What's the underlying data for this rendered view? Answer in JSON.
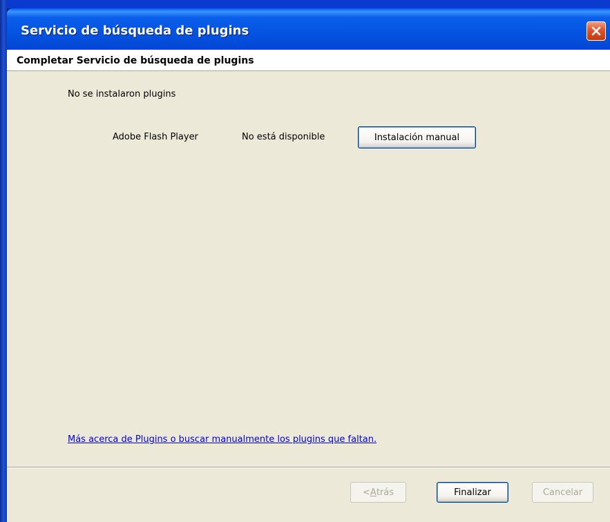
{
  "window": {
    "title": "Servicio de búsqueda de plugins"
  },
  "header": {
    "title": "Completar Servicio de búsqueda de plugins"
  },
  "main": {
    "status_message": "No se instalaron plugins",
    "plugins": [
      {
        "name": "Adobe Flash Player",
        "status": "No está disponible",
        "action_label": "Instalación manual"
      }
    ],
    "more_link": "Más acerca de Plugins o buscar manualmente los plugins que faltan."
  },
  "footer": {
    "back_prefix": "< ",
    "back_accel": "A",
    "back_rest": "trás",
    "finish_label": "Finalizar",
    "cancel_label": "Cancelar"
  },
  "icons": {
    "close": "close-icon"
  },
  "colors": {
    "titlebar": "#0553e1",
    "dialog_bg": "#ece9d8",
    "link": "#0000ee",
    "close_button": "#e0532a"
  }
}
